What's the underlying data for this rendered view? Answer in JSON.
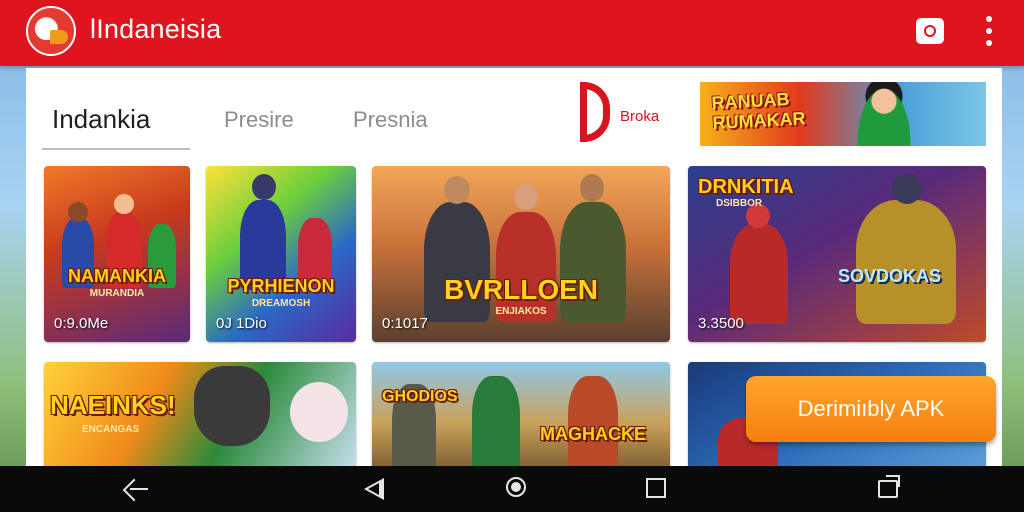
{
  "app": {
    "title": "lIndaneisia",
    "accent_color": "#e0141e",
    "logo_icon": "app-logo-icon",
    "actions": [
      "camera-icon",
      "more-vert-icon"
    ]
  },
  "tabs": [
    {
      "label": "Indankia",
      "active": true
    },
    {
      "label": "Presire",
      "active": false
    },
    {
      "label": "Presnia",
      "active": false
    }
  ],
  "brand": {
    "text": "Broka"
  },
  "banner": {
    "text": "RANUAB RUMAKAR"
  },
  "games": [
    {
      "title": "NAMANKIA",
      "subtitle": "MURANDIA",
      "meta": "0:9.0Me"
    },
    {
      "title": "PYRHIENON",
      "subtitle": "DREAMOSH",
      "meta": "0J 1Dio"
    },
    {
      "title": "BVRLLOEN",
      "subtitle": "ENJIAKOS",
      "meta": "0:1017"
    },
    {
      "title": "DRNKITIA",
      "title2": "SOVDOKAS",
      "subtitle": "DSIBBOR",
      "meta": "3.3500"
    },
    {
      "title": "NAEINKS!",
      "subtitle": "ENCANGAS"
    },
    {
      "title": "GHODIOS",
      "title2": "MAGHACKE",
      "subtitle": ""
    },
    {
      "title": "",
      "subtitle": ""
    }
  ],
  "apk_button": {
    "label": "Derimiıbly APK",
    "color": "#f58a14"
  },
  "navbar": [
    "back-icon",
    "triangle-back-icon",
    "home-icon",
    "recents-icon",
    "switch-apps-icon"
  ]
}
